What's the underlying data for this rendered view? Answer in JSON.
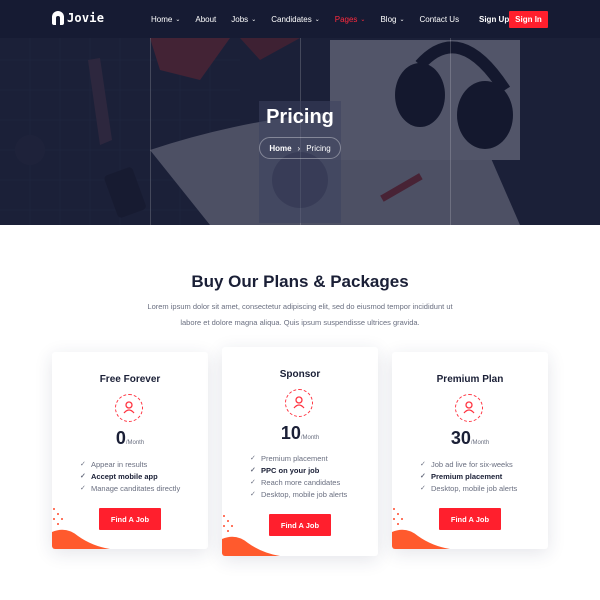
{
  "header": {
    "logo_text": "Jovie",
    "nav": [
      {
        "label": "Home",
        "has_dropdown": true,
        "active": false
      },
      {
        "label": "About",
        "has_dropdown": false,
        "active": false
      },
      {
        "label": "Jobs",
        "has_dropdown": true,
        "active": false
      },
      {
        "label": "Candidates",
        "has_dropdown": true,
        "active": false
      },
      {
        "label": "Pages",
        "has_dropdown": true,
        "active": true
      },
      {
        "label": "Blog",
        "has_dropdown": true,
        "active": false
      },
      {
        "label": "Contact Us",
        "has_dropdown": false,
        "active": false
      }
    ],
    "signup_label": "Sign Up",
    "signin_label": "Sign In"
  },
  "hero": {
    "title": "Pricing",
    "breadcrumb": {
      "home": "Home",
      "separator": "›",
      "current": "Pricing"
    }
  },
  "section": {
    "title": "Buy Our Plans & Packages",
    "description_line1": "Lorem ipsum dolor sit amet, consectetur adipiscing elit, sed do eiusmod tempor incididunt ut",
    "description_line2": "labore et dolore magna aliqua. Quis ipsum suspendisse ultrices gravida."
  },
  "plans": [
    {
      "name": "Free Forever",
      "price": "0",
      "unit": "/Month",
      "features": [
        {
          "text": "Appear in results",
          "bold": false
        },
        {
          "text": "Accept mobile app",
          "bold": true
        },
        {
          "text": "Manage canditates directly",
          "bold": false
        }
      ],
      "button_label": "Find A Job"
    },
    {
      "name": "Sponsor",
      "price": "10",
      "unit": "/Month",
      "features": [
        {
          "text": "Premium placement",
          "bold": false
        },
        {
          "text": "PPC on your job",
          "bold": true
        },
        {
          "text": "Reach more candidates",
          "bold": false
        },
        {
          "text": "Desktop, mobile job alerts",
          "bold": false
        }
      ],
      "button_label": "Find A Job"
    },
    {
      "name": "Premium Plan",
      "price": "30",
      "unit": "/Month",
      "features": [
        {
          "text": "Job ad live for six-weeks",
          "bold": false
        },
        {
          "text": "Premium placement",
          "bold": true
        },
        {
          "text": "Desktop, mobile job alerts",
          "bold": false
        }
      ],
      "button_label": "Find A Job"
    }
  ],
  "icons": {
    "check": "check-icon",
    "plan": "user-icon",
    "dropdown": "chevron-down-icon",
    "breadcrumb_separator": "chevron-right-icon"
  },
  "colors": {
    "accent": "#ff1f2d",
    "header_bg": "#161b33",
    "heading": "#1a1f36",
    "body_text": "#6a6f80"
  }
}
